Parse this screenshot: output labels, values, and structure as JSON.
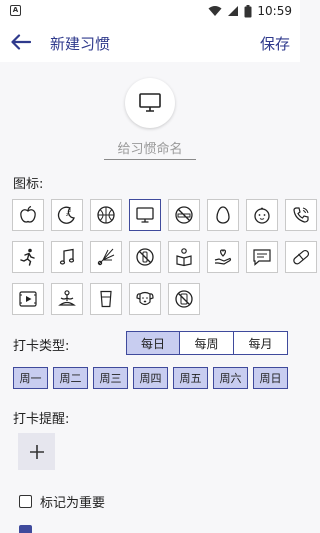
{
  "status_bar": {
    "app_icon_letter": "A",
    "time": "10:59"
  },
  "app_bar": {
    "title": "新建习惯",
    "save_label": "保存"
  },
  "habit_name": {
    "placeholder": "给习惯命名",
    "value": ""
  },
  "icons_section": {
    "label": "图标:",
    "selected_index": 3,
    "icons": [
      "apple-icon",
      "moon-icon",
      "ball-icon",
      "tv-icon",
      "no-smoking-icon",
      "egg-icon",
      "baby-face-icon",
      "phone-call-icon",
      "running-icon",
      "music-note-icon",
      "badminton-icon",
      "no-drinks-icon",
      "reading-icon",
      "heart-hand-icon",
      "chat-icon",
      "pill-icon",
      "video-icon",
      "meditation-icon",
      "glass-icon",
      "dog-icon",
      "no-phone-icon"
    ]
  },
  "checkin_type": {
    "label": "打卡类型:",
    "options": [
      "每日",
      "每周",
      "每月"
    ],
    "selected": "每日"
  },
  "weekdays": [
    "周一",
    "周二",
    "周三",
    "周四",
    "周五",
    "周六",
    "周日"
  ],
  "reminder": {
    "label": "打卡提醒:",
    "add_symbol": "+"
  },
  "important": {
    "label": "标记为重要",
    "checked": false
  },
  "colors": {
    "accent": "#3f4a9c",
    "accent_light": "#c8cdf0",
    "title": "#2f3a8c"
  }
}
